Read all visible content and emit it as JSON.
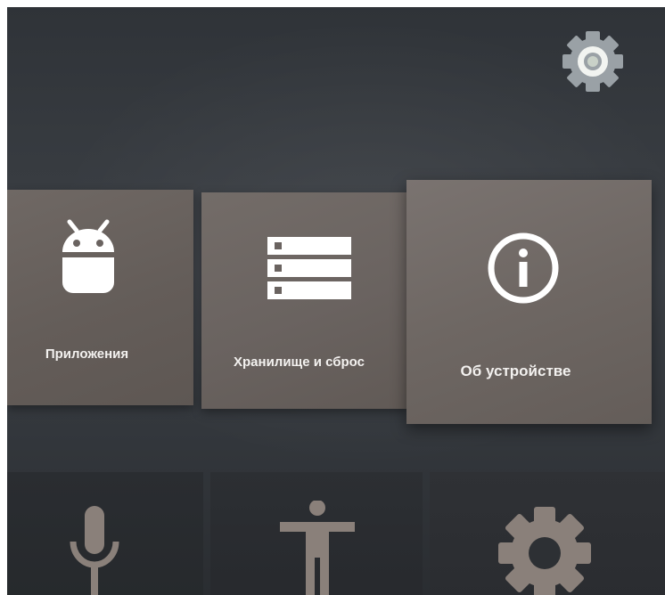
{
  "header": {
    "settings_icon": "gear-icon"
  },
  "cards": [
    {
      "id": "apps",
      "label": "Приложения",
      "icon": "android-icon"
    },
    {
      "id": "storage",
      "label": "Хранилище и сброс",
      "icon": "storage-icon"
    },
    {
      "id": "about",
      "label": "Об устройстве",
      "icon": "info-icon"
    }
  ],
  "bottom_row": [
    {
      "id": "voice",
      "icon": "microphone-icon"
    },
    {
      "id": "accessibility",
      "icon": "accessibility-icon"
    },
    {
      "id": "settings",
      "icon": "gear-icon"
    }
  ],
  "colors": {
    "background": "#33373c",
    "card": "#6a6360",
    "card_focused": "#736c68",
    "icon_white": "#ffffff",
    "bottom_icon": "#8a807a",
    "top_gear_outer": "#9ca3a8",
    "top_gear_inner": "#e9ecea"
  }
}
